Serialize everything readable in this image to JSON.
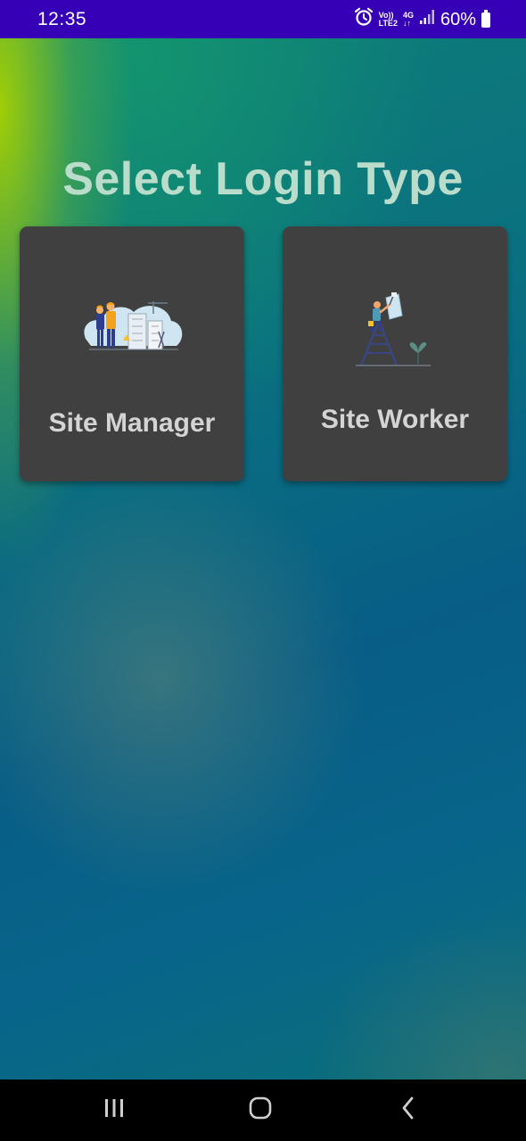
{
  "status_bar": {
    "time": "12:35",
    "network_top": "Vo))",
    "network_bottom": "LTE2",
    "signal_type": "4G",
    "battery": "60%",
    "icons": [
      "alarm-icon",
      "signal-icon",
      "battery-icon"
    ]
  },
  "page": {
    "title": "Select Login Type"
  },
  "login_options": [
    {
      "label": "Site Manager",
      "icon": "construction-workers-illustration"
    },
    {
      "label": "Site Worker",
      "icon": "ladder-worker-illustration"
    }
  ],
  "nav_bar": {
    "buttons": [
      "recent-apps-icon",
      "home-icon",
      "back-icon"
    ]
  },
  "colors": {
    "status_bar": "#3600b6",
    "card": "#404040",
    "title": "#b9dccb",
    "card_label": "#d4d4d4",
    "gradient_accent": "#a8d200"
  }
}
